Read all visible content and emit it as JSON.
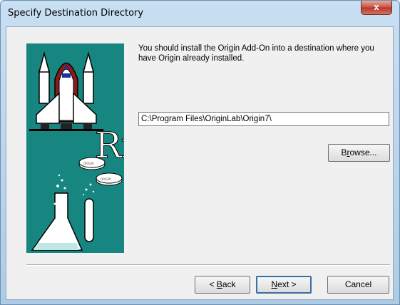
{
  "window": {
    "title": "Specify Destination Directory",
    "close_glyph": "x"
  },
  "dialog": {
    "message": "You should install the Origin Add-On into a destination where you have Origin already installed.",
    "destination_path": "C:\\Program Files\\OriginLab\\Origin7\\",
    "banner_text": "Rx",
    "pill_text": "ORIGIN"
  },
  "buttons": {
    "browse": {
      "pre": "B",
      "acc": "r",
      "post": "owse..."
    },
    "back": {
      "pre": "< ",
      "acc": "B",
      "post": "ack"
    },
    "next": {
      "pre": "",
      "acc": "N",
      "post": "ext >"
    },
    "cancel": "Cancel"
  },
  "colors": {
    "banner_bg": "#188680",
    "title_bar": "#bcd4ec",
    "close_red": "#c75044"
  }
}
